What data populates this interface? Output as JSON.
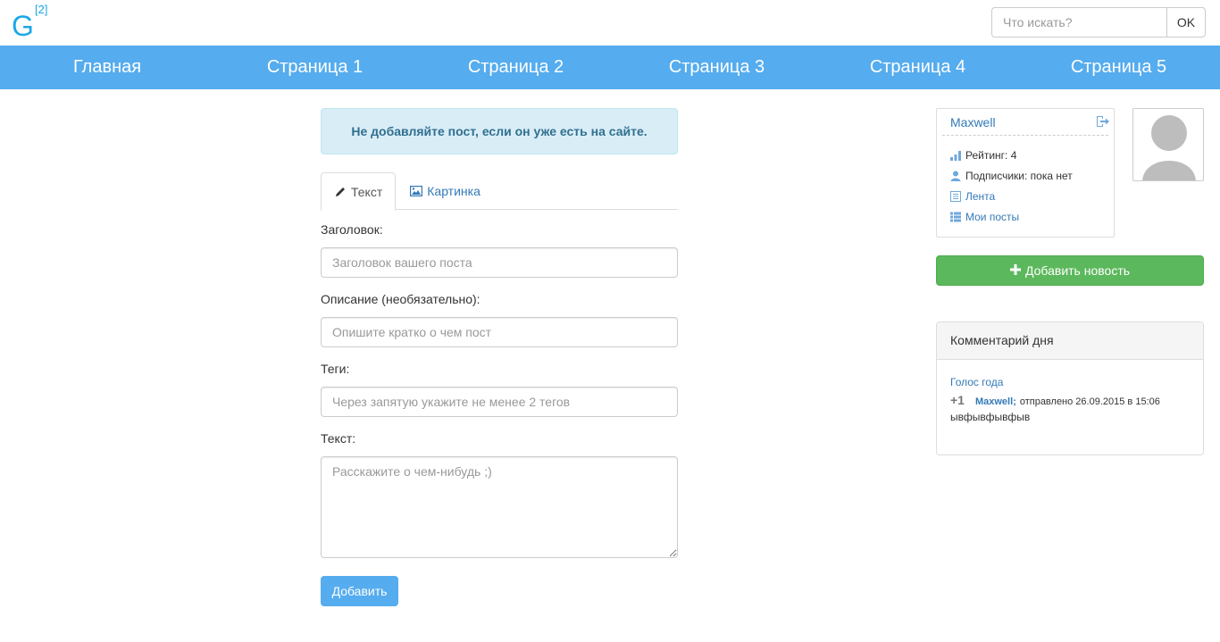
{
  "header": {
    "logo_letter": "G",
    "logo_sup": "[2]",
    "search_placeholder": "Что искать?",
    "search_button": "OK",
    "brand_color": "#1ba8e6"
  },
  "nav": {
    "color": "#55acee",
    "items": [
      "Главная",
      "Страница 1",
      "Страница 2",
      "Страница 3",
      "Страница 4",
      "Страница 5"
    ]
  },
  "alert": {
    "text": "Не добавляйте пост, если он уже есть на сайте."
  },
  "tabs": [
    {
      "label": "Текст",
      "icon": "pencil-icon",
      "active": true
    },
    {
      "label": "Картинка",
      "icon": "picture-icon",
      "active": false
    }
  ],
  "form": {
    "title_label": "Заголовок:",
    "title_placeholder": "Заголовок вашего поста",
    "description_label": "Описание (необязательно):",
    "description_placeholder": "Опишите кратко о чем пост",
    "tags_label": "Теги:",
    "tags_placeholder": "Через запятую укажите не менее 2 тегов",
    "text_label": "Текст:",
    "text_placeholder": "Расскажите о чем-нибудь ;)",
    "submit": "Добавить"
  },
  "user": {
    "name": "Maxwell",
    "rating": "Рейтинг: 4",
    "subscribers": "Подписчики: пока нет",
    "feed": "Лента",
    "my_posts": "Мои посты"
  },
  "sidebar": {
    "add_news": "Добавить новость",
    "add_news_color": "#5cb85c"
  },
  "comment_of_day": {
    "heading": "Комментарий дня",
    "post_title": "Голос года",
    "score": "+1",
    "author": "Maxwell;",
    "sent": "отправлено 26.09.2015 в 15:06",
    "text": "ывфывфывфыв"
  }
}
